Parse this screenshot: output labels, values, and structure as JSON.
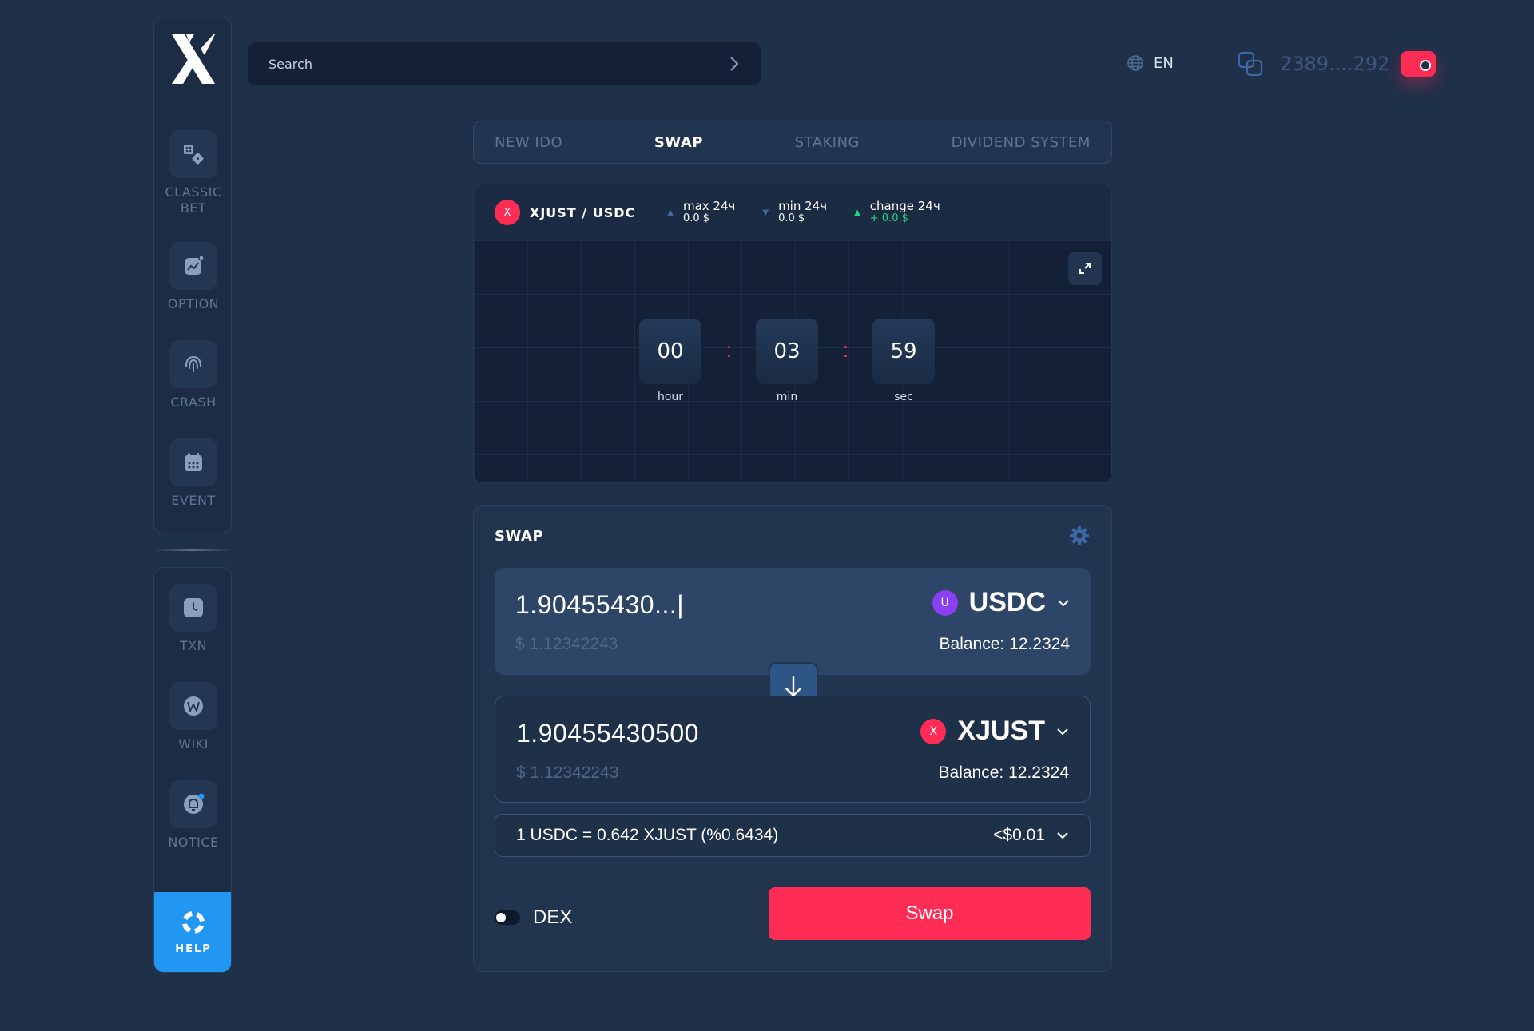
{
  "brand": {
    "logo_icon": "x-logo-icon",
    "accent_color": "#ff2d55",
    "primary_blue": "#2196f3"
  },
  "sidebar": {
    "top_items": [
      {
        "label": "CLASSIC\nBET",
        "line1": "CLASSIC",
        "line2": "BET",
        "icon": "dice-icon"
      },
      {
        "label": "OPTION",
        "icon": "chart-option-icon"
      },
      {
        "label": "CRASH",
        "icon": "fingerprint-icon"
      },
      {
        "label": "EVENT",
        "icon": "calendar-icon"
      }
    ],
    "bottom_items": [
      {
        "label": "TXN",
        "icon": "clock-icon"
      },
      {
        "label": "WIKI",
        "icon": "wiki-icon"
      },
      {
        "label": "NOTICE",
        "icon": "bell-icon"
      }
    ],
    "help": {
      "label": "HELP",
      "icon": "lifebuoy-icon"
    }
  },
  "header": {
    "search": {
      "placeholder": "Search"
    },
    "language": "EN",
    "wallet_address": "2389....292"
  },
  "tabs": [
    {
      "label": "NEW IDO",
      "active": false
    },
    {
      "label": "SWAP",
      "active": true
    },
    {
      "label": "STAKING",
      "active": false
    },
    {
      "label": "DIVIDEND SYSTEM",
      "active": false
    }
  ],
  "chart_panel": {
    "pair_badge": "X",
    "pair": "XJUST / USDC",
    "stats": [
      {
        "title": "max 24ч",
        "value": "0.0 $",
        "trend": "up-muted"
      },
      {
        "title": "min 24ч",
        "value": "0.0 $",
        "trend": "down-muted"
      },
      {
        "title": "change 24ч",
        "value": "+ 0.0 $",
        "trend": "up-green"
      }
    ],
    "countdown": {
      "hours": "00",
      "hours_label": "hour",
      "minutes": "03",
      "minutes_label": "min",
      "seconds": "59",
      "seconds_label": "sec"
    }
  },
  "swap": {
    "title": "SWAP",
    "from": {
      "amount": "1.90455430...|",
      "usd": "$ 1.12342243",
      "token_badge": "U",
      "token": "USDC",
      "balance": "Balance: 12.2324"
    },
    "to": {
      "amount": "1.90455430500",
      "usd": "$ 1.12342243",
      "token_badge": "X",
      "token": "XJUST",
      "balance": "Balance: 12.2324"
    },
    "rate": "1 USDC = 0.642 XJUST (%0.6434)",
    "fee": "<$0.01",
    "dex_label": "DEX",
    "dex_enabled": false,
    "swap_button": "Swap"
  }
}
